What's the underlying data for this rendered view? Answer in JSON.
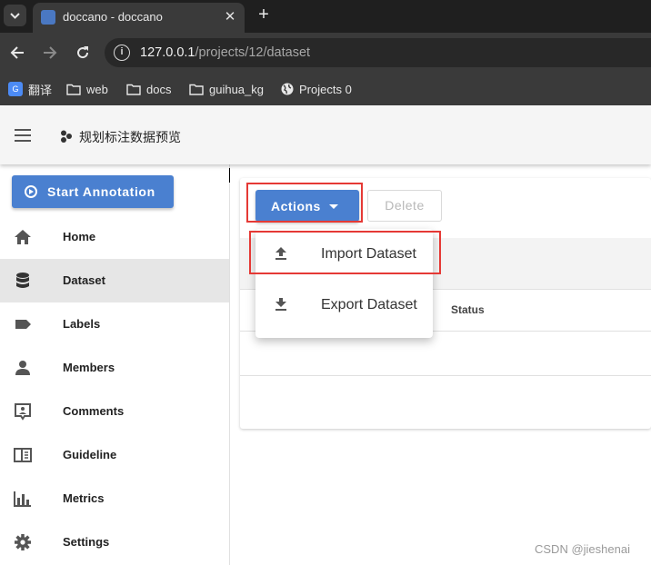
{
  "browser": {
    "tab_title": "doccano - doccano",
    "url_host": "127.0.0.1",
    "url_path": "/projects/12/dataset",
    "bookmarks": [
      {
        "label": "翻译",
        "icon": "translate-icon"
      },
      {
        "label": "web",
        "icon": "folder-icon"
      },
      {
        "label": "docs",
        "icon": "folder-icon"
      },
      {
        "label": "guihua_kg",
        "icon": "folder-icon"
      },
      {
        "label": "Projects 0",
        "icon": "globe-icon"
      }
    ]
  },
  "app": {
    "project_title": "规划标注数据预览"
  },
  "sidebar": {
    "start_button": "Start Annotation",
    "items": [
      {
        "label": "Home",
        "icon": "home-icon"
      },
      {
        "label": "Dataset",
        "icon": "database-icon",
        "active": true
      },
      {
        "label": "Labels",
        "icon": "label-icon"
      },
      {
        "label": "Members",
        "icon": "person-icon"
      },
      {
        "label": "Comments",
        "icon": "comment-icon"
      },
      {
        "label": "Guideline",
        "icon": "book-icon"
      },
      {
        "label": "Metrics",
        "icon": "chart-icon"
      },
      {
        "label": "Settings",
        "icon": "gear-icon"
      }
    ]
  },
  "toolbar": {
    "actions_label": "Actions",
    "delete_label": "Delete"
  },
  "menu": {
    "items": [
      {
        "label": "Import Dataset",
        "icon": "upload-icon"
      },
      {
        "label": "Export Dataset",
        "icon": "download-icon"
      }
    ]
  },
  "table": {
    "status_header": "Status"
  },
  "watermark": "CSDN @jieshenai",
  "colors": {
    "accent": "#4a80d0",
    "highlight": "#e53935"
  }
}
